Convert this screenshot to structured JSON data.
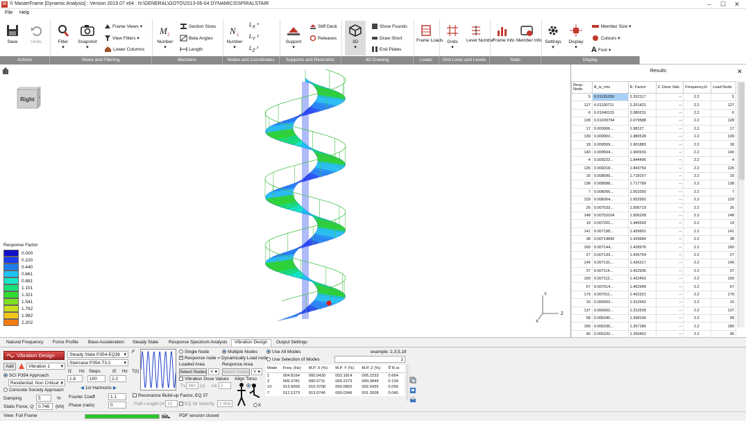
{
  "window": {
    "title": "© MasterFrame [Dynamic Analysis] : Version 2019.07 x64 : N:\\GENERAL\\GOTO\\2013-06-04 DYNAMICS\\SPIRALSTAIR",
    "app_icon": "m",
    "min": "–",
    "max": "☐",
    "close": "✕"
  },
  "menu": [
    "File",
    "Help"
  ],
  "ribbon": {
    "save": "Save",
    "undo": "Undo",
    "filter": "Filter",
    "snapshot": "Snapshot",
    "frame_views": "Frame Views",
    "view_filters": "View Filters",
    "lower_columns": "Lower Columns",
    "number_m": "Number",
    "section_sizes": "Section Sizes",
    "beta_angles": "Beta Angles",
    "length": "Length",
    "number_n": "Number",
    "support": "Support",
    "stiff_deck": "Stiff Deck",
    "releases": "Releases",
    "three_d": "3D",
    "show_founds": "Show Founds",
    "draw_short": "Draw Short",
    "end_plates": "End Plates",
    "frame_loads": "Frame Loads",
    "grids": "Grids",
    "level_number": "Level Number",
    "frame_info": "Frame Info",
    "member_info": "Member Info",
    "settings": "Settings",
    "display": "Display",
    "member_size": "Member Size",
    "colours": "Colours",
    "font": "Font"
  },
  "ribbon_groups": [
    "Actions",
    "Views and Filtering",
    "Members",
    "Nodes and Coordinates",
    "Supports and Restraints",
    "3D Drawing",
    "Loads",
    "Grid Lines and Levels",
    "Stats",
    "Display"
  ],
  "viewcube_label": "Right",
  "legend": {
    "title": "Response Factor",
    "entries": [
      {
        "value": "0.000",
        "color": "#1010c8"
      },
      {
        "value": "0.220",
        "color": "#1e3cf0"
      },
      {
        "value": "0.440",
        "color": "#1c7ef5"
      },
      {
        "value": "0.661",
        "color": "#1cc1f5"
      },
      {
        "value": "0.881",
        "color": "#16e8c8"
      },
      {
        "value": "1.101",
        "color": "#18e07a"
      },
      {
        "value": "1.321",
        "color": "#30dc30"
      },
      {
        "value": "1.541",
        "color": "#7ee020"
      },
      {
        "value": "1.762",
        "color": "#c8e018"
      },
      {
        "value": "1.982",
        "color": "#f5c818"
      },
      {
        "value": "2.202",
        "color": "#f57c10"
      }
    ]
  },
  "axes": {
    "y": "Y",
    "x": "X",
    "z": "Z"
  },
  "results": {
    "title": "Results",
    "close": "✕",
    "columns": [
      "Resp. Node",
      "A_w_rms",
      "R. Factor",
      "V. Dose Vals",
      "Frequency,H",
      "Load Node"
    ],
    "rows": [
      [
        "5",
        "0.01101059",
        "2.202117",
        "--",
        "2.2",
        "5"
      ],
      [
        "127",
        "0.01100711",
        "2.201421",
        "--",
        "2.2",
        "127"
      ],
      [
        "6",
        "0.01040115",
        "2.080231",
        "--",
        "2.2",
        "6"
      ],
      [
        "128",
        "0.01039794",
        "2.079588",
        "--",
        "2.2",
        "128"
      ],
      [
        "17",
        "0.009906...",
        "1.98127",
        "--",
        "2.2",
        "17"
      ],
      [
        "139",
        "0.009902...",
        "1.980528",
        "--",
        "2.2",
        "139"
      ],
      [
        "18",
        "0.009509...",
        "1.901883",
        "--",
        "2.2",
        "18"
      ],
      [
        "140",
        "0.009504...",
        "1.900916",
        "--",
        "2.2",
        "140"
      ],
      [
        "4",
        "0.009222...",
        "1.844496",
        "--",
        "2.2",
        "4"
      ],
      [
        "126",
        "0.009218...",
        "1.843759",
        "--",
        "2.2",
        "126"
      ],
      [
        "16",
        "0.008590...",
        "1.718157",
        "--",
        "2.2",
        "16"
      ],
      [
        "138",
        "0.008588...",
        "1.717789",
        "--",
        "2.2",
        "138"
      ],
      [
        "7",
        "0.008266...",
        "1.653392",
        "--",
        "2.2",
        "7"
      ],
      [
        "129",
        "0.008264...",
        "1.652992",
        "--",
        "2.2",
        "129"
      ],
      [
        "26",
        "0.007533...",
        "1.506719",
        "--",
        "2.2",
        "26"
      ],
      [
        "148",
        "0.00753104",
        "1.506208",
        "--",
        "2.2",
        "148"
      ],
      [
        "19",
        "0.007202...",
        "1.440593",
        "--",
        "2.2",
        "19"
      ],
      [
        "141",
        "0.007198...",
        "1.439601",
        "--",
        "2.2",
        "141"
      ],
      [
        "38",
        "0.00714842",
        "1.429684",
        "--",
        "2.2",
        "38"
      ],
      [
        "160",
        "0.007144...",
        "1.428976",
        "--",
        "2.2",
        "160"
      ],
      [
        "27",
        "0.007133...",
        "1.426754",
        "--",
        "2.2",
        "27"
      ],
      [
        "149",
        "0.007131...",
        "1.426317",
        "--",
        "2.2",
        "149"
      ],
      [
        "37",
        "0.007114...",
        "1.422936",
        "--",
        "2.2",
        "37"
      ],
      [
        "159",
        "0.007112...",
        "1.422453",
        "--",
        "2.2",
        "159"
      ],
      [
        "57",
        "0.007014...",
        "1.402949",
        "--",
        "2.2",
        "57"
      ],
      [
        "179",
        "0.007011...",
        "1.402321",
        "--",
        "2.2",
        "179"
      ],
      [
        "15",
        "0.006563...",
        "1.312642",
        "--",
        "2.2",
        "15"
      ],
      [
        "137",
        "0.006562...",
        "1.312539",
        "--",
        "2.2",
        "137"
      ],
      [
        "58",
        "0.006340...",
        "1.268106",
        "--",
        "2.2",
        "58"
      ],
      [
        "180",
        "0.006335...",
        "1.267186",
        "--",
        "2.2",
        "180"
      ],
      [
        "46",
        "0.006332...",
        "1.266452",
        "--",
        "2.2",
        "46"
      ]
    ]
  },
  "tabs": [
    "Natural Frequency",
    "Force Profile",
    "Base Acceleration",
    "Steady State",
    "Response Spectrum Analysis",
    "Vibration Design",
    "Output Settings"
  ],
  "vib": {
    "banner": "Vibration Design",
    "add": "Add",
    "vib_select": "Vibration 1",
    "method": "Steady State P354-EQ36",
    "staircase": "Staircase P354-T3.2",
    "f1_label": "f1",
    "hz1": "Hz",
    "steps_label": "Steps",
    "f2_label": "f2",
    "hz2": "Hz",
    "f1_val": "1.8",
    "steps_val": "100",
    "f2_val": "2.2",
    "harmonic": "1st Harmonic",
    "sci": "SCI P354 Approach",
    "residential": "Residential, Non Critical ...",
    "concrete": "Concrete Society Approach",
    "damping_label": "Damping",
    "damping_val": "5",
    "pct": "%",
    "fourier_label": "Fourier Coeff",
    "fourier_val": "1.1",
    "static_label": "Static Force, Q",
    "static_val": "0.746",
    "kn": "(kN)",
    "phase_label": "Phase (rads)",
    "phase_val": "0",
    "graph_f": "F",
    "graph_t": "T(t)",
    "single_node": "Single Node",
    "multiple_nodes": "Multiple Nodes",
    "resp_eq": "Response node = Dynamically Load node",
    "loaded_area": "Loaded Area",
    "response_area": "Response Area",
    "select_nodes": "Select Nodes",
    "select_nodes2": "Select Nodes",
    "y_sel": "Y",
    "y_sel2": "Y",
    "vib_dose": "Vibration Dose Values",
    "tv_label": "Tv",
    "tv_val": "360",
    "tv_unit": "(s)",
    "na_label": "na",
    "na_val": "2",
    "align_torso": "Align Torso",
    "resonance": "Resonance Build-up Factor, EQ 37",
    "path_length": "Path Length (m)",
    "path_val": "10",
    "eq16": "EQ 16 Velocity",
    "eq16_val": "1.956",
    "use_all": "Use All Modes",
    "use_sel": "Use Selection of Modes",
    "example": "example: 2,3,5,18",
    "mode_sel_val": "1",
    "axis_y": "Y",
    "axis_x": "X"
  },
  "modes": {
    "columns": [
      "Mode",
      "Freq. (Hz)",
      "M.P. X (%)",
      "M.P. Y (%)",
      "M.P. Z (%)",
      "∇ R.w."
    ],
    "rows": [
      [
        "1",
        "004.8164",
        "000.0430",
        "003.1814",
        "005.2233",
        "0.664"
      ],
      [
        "2",
        "006.3781",
        "000.0711",
        "000.2273",
        "000.3844",
        "0.134"
      ],
      [
        "10",
        "013.9000",
        "010.3708",
        "000.0802",
        "002.0435",
        "0.055"
      ],
      [
        "7",
        "012.1373",
        "013.0746",
        "000.0349",
        "001.3928",
        "0.045"
      ]
    ]
  },
  "status": {
    "view": "View: Full Frame",
    "pdf": "PDF session closed",
    "progress": 1.0
  }
}
